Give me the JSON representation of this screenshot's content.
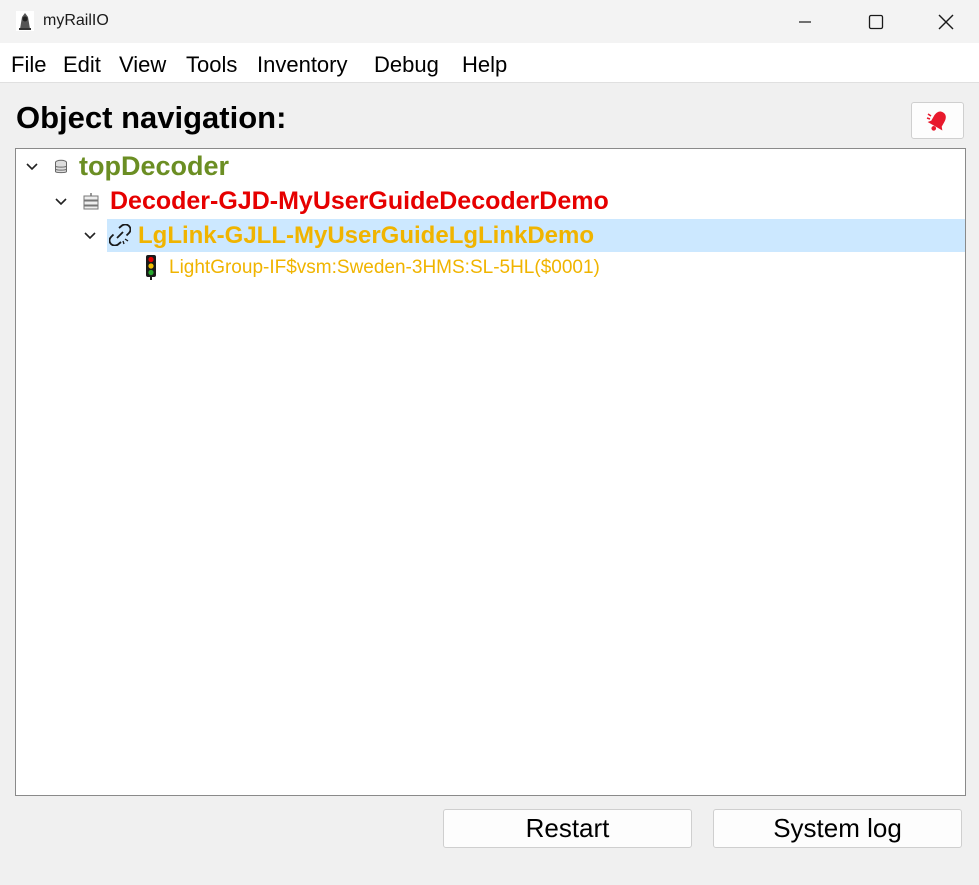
{
  "window": {
    "title": "myRailIO",
    "app_icon": "app-logo-icon",
    "controls": [
      "minimize-icon",
      "maximize-icon",
      "close-icon"
    ]
  },
  "menu": {
    "items": [
      "File",
      "Edit",
      "View",
      "Tools",
      "Inventory",
      "Debug",
      "Help"
    ]
  },
  "panel": {
    "title": "Object navigation:",
    "alarm_icon": "alarm-bell-icon"
  },
  "tree": {
    "nodes": [
      {
        "label": "topDecoder",
        "icon": "database-icon",
        "color": "#6b8e23",
        "expanded": true
      },
      {
        "label": "Decoder-GJD-MyUserGuideDecoderDemo",
        "icon": "decoder-icon",
        "color": "#e60000",
        "expanded": true
      },
      {
        "label": "LgLink-GJLL-MyUserGuideLgLinkDemo",
        "icon": "broken-link-icon",
        "color": "#f0b400",
        "expanded": true,
        "selected": true
      },
      {
        "label": "LightGroup-IF$vsm:Sweden-3HMS:SL-5HL($0001)",
        "icon": "traffic-light-icon",
        "color": "#f0b400"
      }
    ]
  },
  "buttons": {
    "restart": "Restart",
    "system_log": "System log"
  }
}
